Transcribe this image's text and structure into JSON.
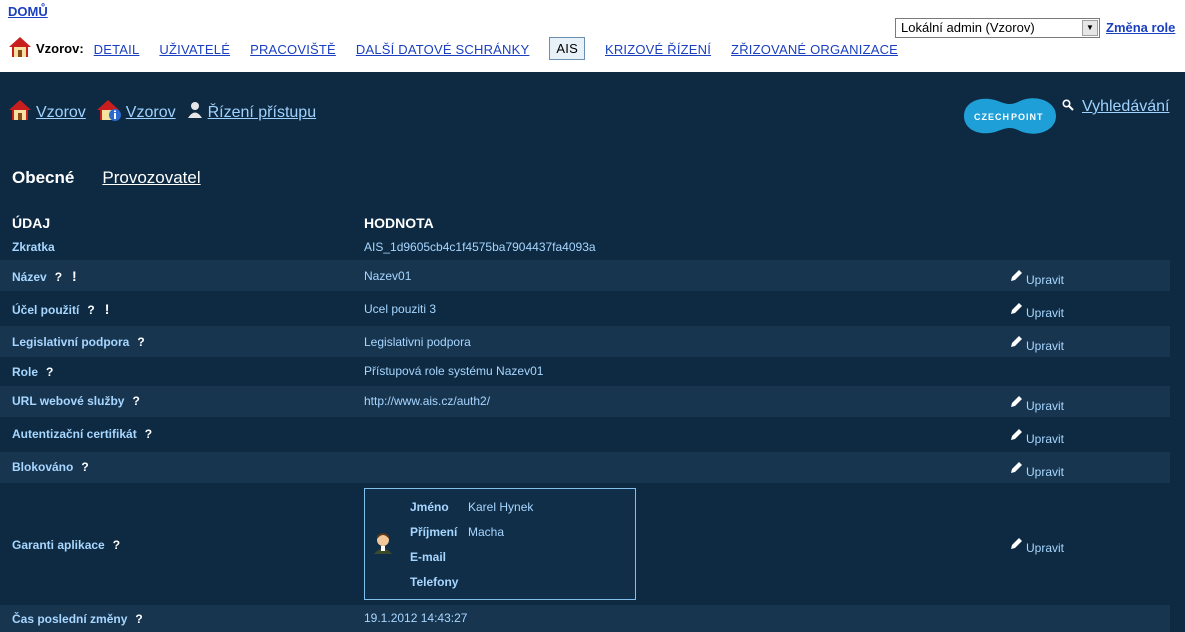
{
  "header": {
    "home_link": "DOMŮ",
    "role_select_value": "Lokální admin (Vzorov)",
    "role_change": "Změna role",
    "org_label": "Vzorov:",
    "nav": [
      "DETAIL",
      "UŽIVATELÉ",
      "PRACOVIŠTĚ",
      "DALŠÍ DATOVÉ SCHRÁNKY",
      "AIS",
      "KRIZOVÉ ŘÍZENÍ",
      "ZŘIZOVANÉ ORGANIZACE"
    ]
  },
  "breadcrumb": [
    "Vzorov",
    "Vzorov",
    "Řízení přístupu"
  ],
  "logo": {
    "line1": "CZECH",
    "line2": "POINT",
    "color": "#1e9fd8"
  },
  "search_label": "Vyhledávání",
  "tabs": {
    "general": "Obecné",
    "operator": "Provozovatel"
  },
  "columns": {
    "field": "ÚDAJ",
    "value": "HODNOTA"
  },
  "edit_label": "Upravit",
  "rows": [
    {
      "label": "Zkratka",
      "value": "AIS_1d9605cb4c1f4575ba7904437fa4093a"
    },
    {
      "label": "Název",
      "value": "Nazev01"
    },
    {
      "label": "Účel použití",
      "value": "Ucel pouziti 3"
    },
    {
      "label": "Legislativní podpora",
      "value": "Legislativni podpora"
    },
    {
      "label": "Role",
      "value": "Přístupová role systému Nazev01"
    },
    {
      "label": "URL webové služby",
      "value": "http://www.ais.cz/auth2/"
    },
    {
      "label": "Autentizační certifikát",
      "value": ""
    },
    {
      "label": "Blokováno",
      "value": ""
    },
    {
      "label": "Garanti aplikace",
      "value": ""
    },
    {
      "label": "Čas poslední změny",
      "value": "19.1.2012 14:43:27"
    }
  ],
  "guarantor": {
    "first_name_label": "Jméno",
    "first_name": "Karel Hynek",
    "last_name_label": "Příjmení",
    "last_name": "Macha",
    "email_label": "E-mail",
    "email": "",
    "phone_label": "Telefony",
    "phone": ""
  },
  "colors": {
    "background": "#0e2a42",
    "row_shade": "#183550",
    "link": "#9fd2ff",
    "top_link": "#1a3fbf"
  }
}
